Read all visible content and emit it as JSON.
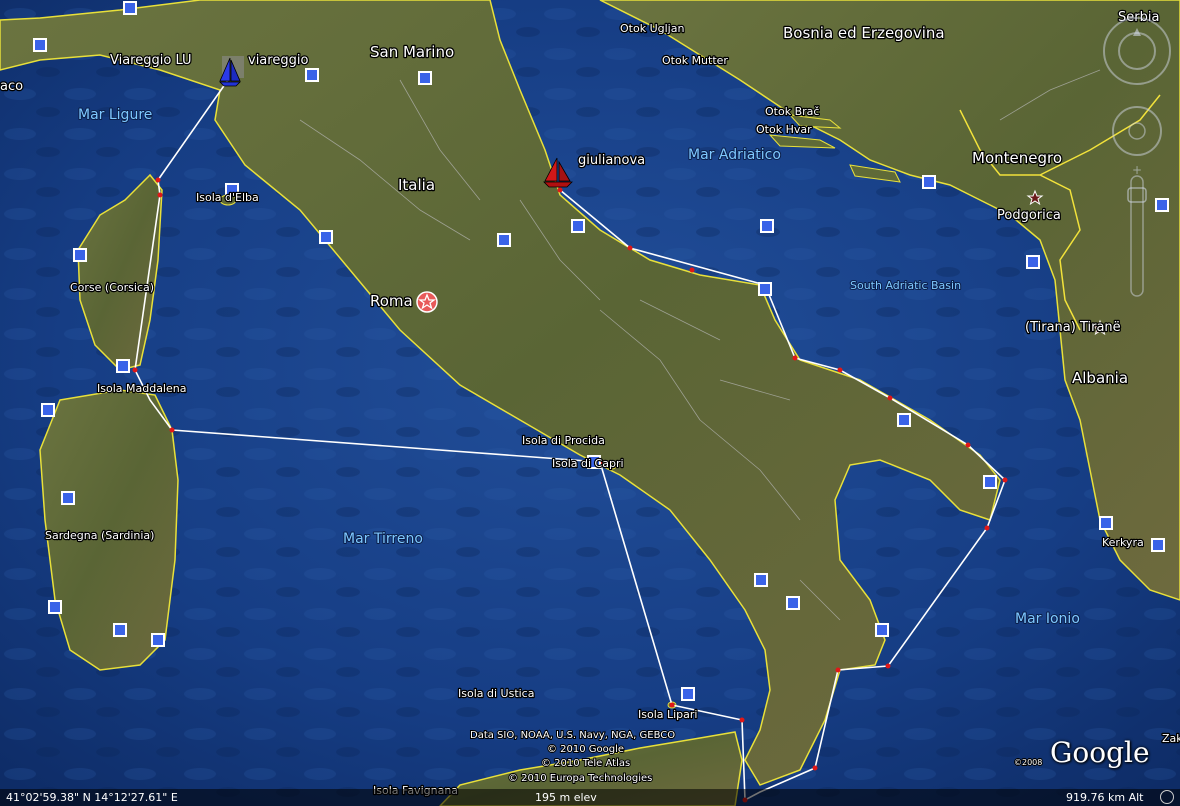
{
  "places": {
    "serbia": "Serbia",
    "bosnia": "Bosnia ed Erzegovina",
    "otok_ugljan": "Otok Ugljan",
    "otok_mutter": "Otok Mutter",
    "otok_brac": "Otok Brač",
    "otok_hvar": "Otok Hvar",
    "mar_adriatico": "Mar Adriatico",
    "montenegro": "Montenegro",
    "podgorica": "Podgorica",
    "south_adriatic": "South Adriatic Basin",
    "tirana": "(Tirana) Tiranë",
    "albania": "Albania",
    "kerkyra": "Kerkyra",
    "mar_ionio": "Mar Ionio",
    "san_marino": "San Marino",
    "italia": "Italia",
    "roma": "Roma",
    "mar_ligure": "Mar Ligure",
    "isola_elba": "Isola d'Elba",
    "corse": "Corse (Corsica)",
    "isola_maddalena": "Isola Maddalena",
    "sardegna": "Sardegna (Sardinia)",
    "mar_tirreno": "Mar Tirreno",
    "isola_procida": "Isola di Procida",
    "isola_capri": "Isola di Capri",
    "isola_ustica": "Isola di Ustica",
    "isola_lipari": "Isola Lipari",
    "isola_favignana": "Isola Favignana",
    "monaco": "aco",
    "zak": "Zak"
  },
  "placemarks": {
    "viareggio_lu": "Viareggio LU",
    "viareggio": "viareggio",
    "giulianova": "giulianova"
  },
  "attribution": {
    "line1": "Data SIO, NOAA, U.S. Navy, NGA, GEBCO",
    "line2": "© 2010 Google",
    "line3": "© 2010 Tele Atlas",
    "line4": "© 2010 Europa Technologies",
    "year_small": "©2008",
    "logo": "Google"
  },
  "status": {
    "coords": "41°02'59.38\" N    14°12'27.61\" E",
    "elev": "195 m elev",
    "eye_alt": "919.76 km  Alt"
  },
  "colors": {
    "sea": "#173f85",
    "land": "#5d6a39",
    "coast": "#e8e03a",
    "route": "#ffffff",
    "route_marker": "#e01818",
    "sea_label": "#7ec8ff"
  },
  "icons": {
    "sailboat_blue": "sailboat-blue-icon",
    "sailboat_red": "sailboat-red-icon",
    "capital": "capital-star-icon",
    "poi": "poi-square-icon"
  }
}
